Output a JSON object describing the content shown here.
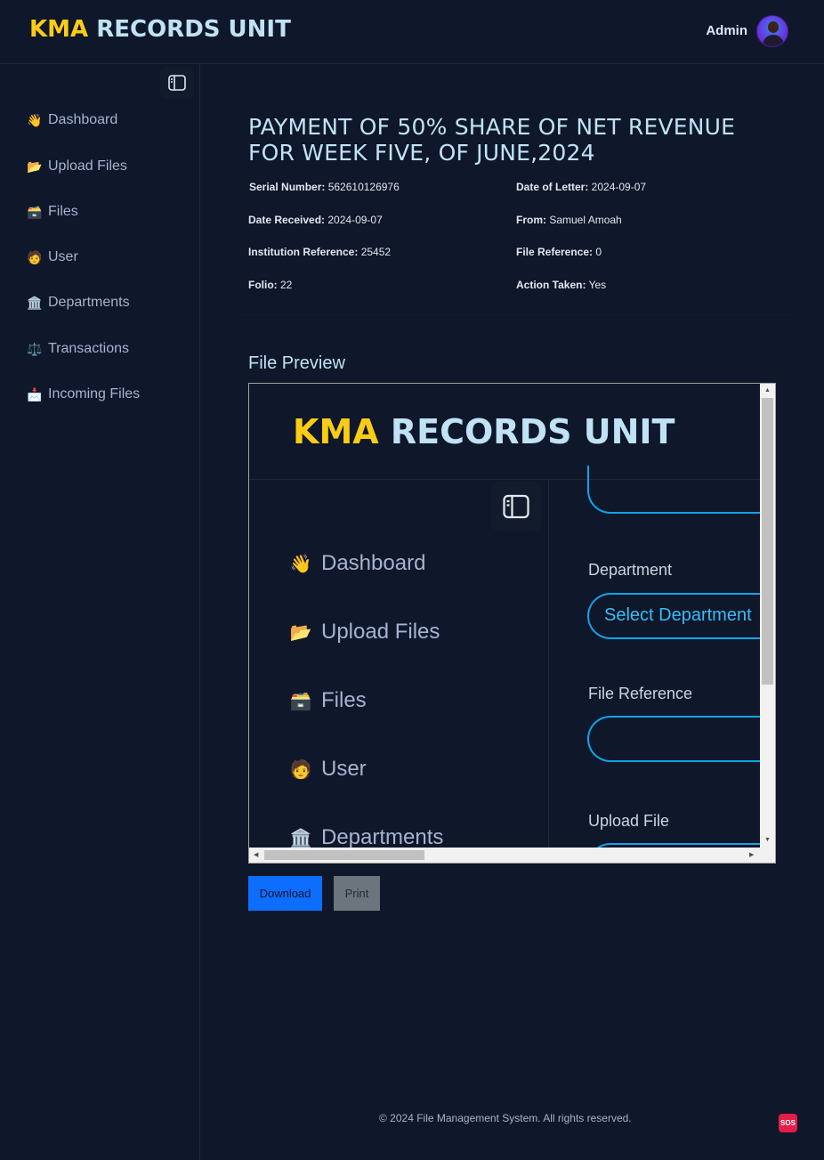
{
  "header": {
    "brand_kma": "KMA",
    "brand_rest": " RECORDS UNIT",
    "user_label": "Admin"
  },
  "sidebar": {
    "items": [
      {
        "icon": "👋",
        "label": "Dashboard"
      },
      {
        "icon": "📂",
        "label": "Upload Files"
      },
      {
        "icon": "🗃️",
        "label": "Files"
      },
      {
        "icon": "🧑",
        "label": "User"
      },
      {
        "icon": "🏛️",
        "label": "Departments"
      },
      {
        "icon": "⚖️",
        "label": "Transactions"
      },
      {
        "icon": "📩",
        "label": "Incoming Files"
      }
    ]
  },
  "document": {
    "title": "PAYMENT OF 50% SHARE OF NET REVENUE FOR WEEK FIVE, OF JUNE,2024",
    "fields": {
      "serial_label": "Serial Number:",
      "serial_value": " 562610126976",
      "date_letter_label": "Date of Letter:",
      "date_letter_value": " 2024-09-07",
      "date_received_label": "Date Received:",
      "date_received_value": " 2024-09-07",
      "from_label": "From:",
      "from_value": " Samuel Amoah",
      "inst_ref_label": "Institution Reference:",
      "inst_ref_value": " 25452",
      "file_ref_label": "File Reference:",
      "file_ref_value": " 0",
      "folio_label": "Folio:",
      "folio_value": " 22",
      "action_label": "Action Taken:",
      "action_value": " Yes"
    }
  },
  "preview": {
    "heading": "File Preview",
    "brand_kma": "KMA",
    "brand_rest": " RECORDS UNIT",
    "nav": [
      {
        "icon": "👋",
        "label": "Dashboard"
      },
      {
        "icon": "📂",
        "label": "Upload Files"
      },
      {
        "icon": "🗃️",
        "label": "Files"
      },
      {
        "icon": "🧑",
        "label": "User"
      },
      {
        "icon": "🏛️",
        "label": "Departments"
      }
    ],
    "department_label": "Department",
    "department_select": "Select Department",
    "file_reference_label": "File Reference",
    "upload_file_label": "Upload File"
  },
  "actions": {
    "download_label": "Download",
    "print_label": "Print"
  },
  "footer": {
    "text": "© 2024 File Management System. All rights reserved.",
    "sos_label": "SOS"
  },
  "colors": {
    "background": "#0f172a",
    "brand_accent": "#facc15",
    "primary_button": "#0d6efd",
    "secondary_button": "#6c757d",
    "sos": "#e11d48"
  }
}
